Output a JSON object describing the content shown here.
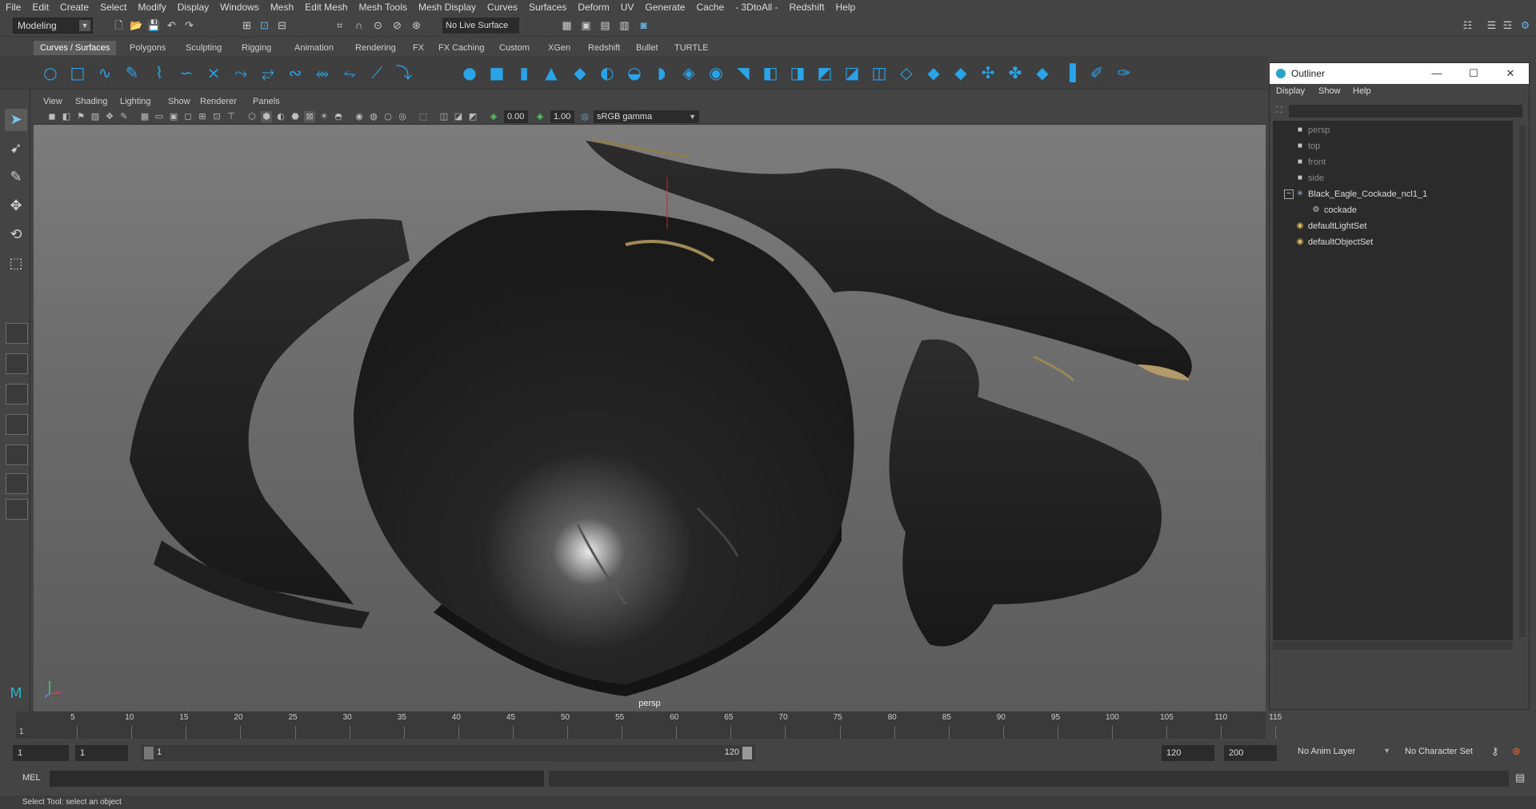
{
  "menubar": {
    "items": [
      "File",
      "Edit",
      "Create",
      "Select",
      "Modify",
      "Display",
      "Windows",
      "Mesh",
      "Edit Mesh",
      "Mesh Tools",
      "Mesh Display",
      "Curves",
      "Surfaces",
      "Deform",
      "UV",
      "Generate",
      "Cache",
      "- 3DtoAll -",
      "Redshift",
      "Help"
    ]
  },
  "statusline": {
    "menuset": "Modeling",
    "live_surface": "No Live Surface"
  },
  "shelf": {
    "tabs": [
      "Curves / Surfaces",
      "Polygons",
      "Sculpting",
      "Rigging",
      "Animation",
      "Rendering",
      "FX",
      "FX Caching",
      "Custom",
      "XGen",
      "Redshift",
      "Bullet",
      "TURTLE"
    ],
    "active_tab": "Curves / Surfaces"
  },
  "viewport": {
    "menu": [
      "View",
      "Shading",
      "Lighting",
      "Show",
      "Renderer",
      "Panels"
    ],
    "exposure": "0.00",
    "gamma": "1.00",
    "color_space": "sRGB gamma",
    "camera_label": "persp"
  },
  "outliner": {
    "title": "Outliner",
    "menu": [
      "Display",
      "Show",
      "Help"
    ],
    "items": [
      {
        "label": "persp",
        "icon": "camera-icon",
        "dim": true
      },
      {
        "label": "top",
        "icon": "camera-icon",
        "dim": true
      },
      {
        "label": "front",
        "icon": "camera-icon",
        "dim": true
      },
      {
        "label": "side",
        "icon": "camera-icon",
        "dim": true
      },
      {
        "label": "Black_Eagle_Cockade_ncl1_1",
        "icon": "group-icon",
        "dim": false
      },
      {
        "label": "cockade",
        "icon": "mesh-icon",
        "dim": false
      },
      {
        "label": "defaultLightSet",
        "icon": "set-icon",
        "dim": false
      },
      {
        "label": "defaultObjectSet",
        "icon": "set-icon",
        "dim": false
      }
    ]
  },
  "timeline": {
    "ticks": [
      "5",
      "10",
      "15",
      "20",
      "25",
      "30",
      "35",
      "40",
      "45",
      "50",
      "55",
      "60",
      "65",
      "70",
      "75",
      "80",
      "85",
      "90",
      "95",
      "100",
      "105",
      "110",
      "115"
    ],
    "current_frame": "1"
  },
  "range": {
    "start": "1",
    "playback_start": "1",
    "slider_start": "1",
    "slider_end": "120",
    "playback_end": "120",
    "end": "200",
    "anim_layer": "No Anim Layer",
    "character_set": "No Character Set"
  },
  "cmdline": {
    "label": "MEL"
  },
  "helpline": {
    "text": "Select Tool: select an object"
  },
  "colors": {
    "accent": "#2aa3e8",
    "background": "#444444",
    "viewport": "#6e6e6e"
  }
}
